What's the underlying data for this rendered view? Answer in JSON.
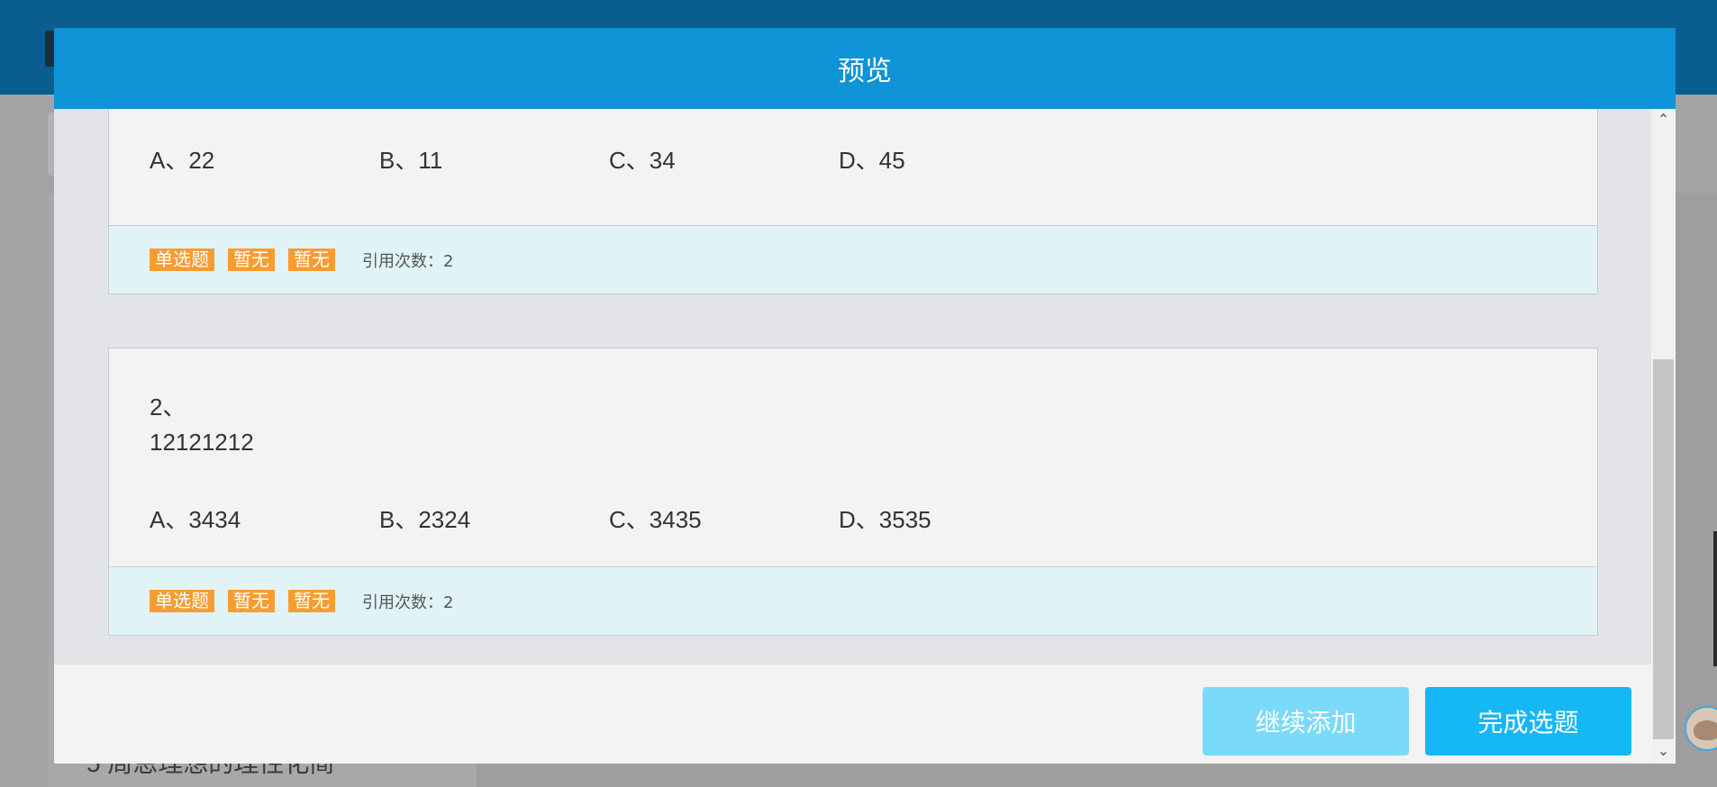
{
  "background": {
    "page_text": "5 周恩理想的理性化简"
  },
  "modal": {
    "title": "预览",
    "questions": [
      {
        "number": "",
        "text": "",
        "options": [
          "A、22",
          "B、11",
          "C、34",
          "D、45"
        ],
        "tags": [
          "单选题",
          "暂无",
          "暂无"
        ],
        "ref_count": "引用次数：2"
      },
      {
        "number": "2、",
        "text": "12121212",
        "options": [
          "A、3434",
          "B、2324",
          "C、3435",
          "D、3535"
        ],
        "tags": [
          "单选题",
          "暂无",
          "暂无"
        ],
        "ref_count": "引用次数：2"
      }
    ],
    "buttons": {
      "continue_label": "继续添加",
      "finish_label": "完成选题"
    }
  },
  "colors": {
    "header": "#0e93d6",
    "tag": "#f89c30",
    "button_continue": "#7bdaf9",
    "button_finish": "#15b7f5",
    "footer_bar": "#e0f4f7"
  },
  "icons": {
    "scroll_up": "chevron-up-icon",
    "scroll_down": "chevron-down-icon"
  }
}
